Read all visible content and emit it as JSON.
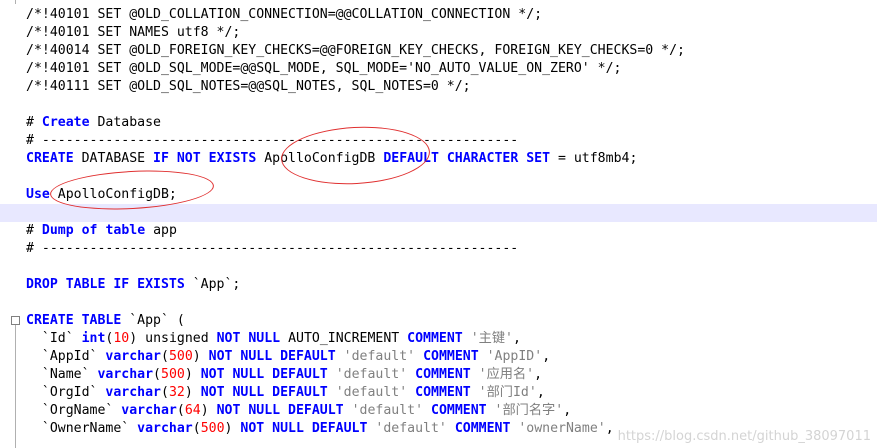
{
  "colors": {
    "keyword": "#0000ff",
    "default_text": "#000000",
    "string": "#808080",
    "number": "#ff0000",
    "active_line_background": "#e8e8ff",
    "annotation": "#e03030",
    "watermark": "#d4d4d4"
  },
  "editor": {
    "lines": [
      {
        "tokens": [
          {
            "t": "/*!40101 SET @OLD_COLLATION_CONNECTION=@@COLLATION_CONNECTION */;",
            "c": "p"
          }
        ]
      },
      {
        "tokens": [
          {
            "t": "/*!40101 SET NAMES utf8 */;",
            "c": "p"
          }
        ]
      },
      {
        "tokens": [
          {
            "t": "/*!40014 SET @OLD_FOREIGN_KEY_CHECKS=@@FOREIGN_KEY_CHECKS, FOREIGN_KEY_CHECKS=0 */;",
            "c": "p"
          }
        ]
      },
      {
        "tokens": [
          {
            "t": "/*!40101 SET @OLD_SQL_MODE=@@SQL_MODE, SQL_MODE='NO_AUTO_VALUE_ON_ZERO' */;",
            "c": "p"
          }
        ]
      },
      {
        "tokens": [
          {
            "t": "/*!40111 SET @OLD_SQL_NOTES=@@SQL_NOTES, SQL_NOTES=0 */;",
            "c": "p"
          }
        ]
      },
      {
        "tokens": []
      },
      {
        "tokens": [
          {
            "t": "# ",
            "c": "p"
          },
          {
            "t": "Create",
            "c": "k"
          },
          {
            "t": " Database",
            "c": "p"
          }
        ]
      },
      {
        "tokens": [
          {
            "t": "# ------------------------------------------------------------",
            "c": "p"
          }
        ]
      },
      {
        "tokens": [
          {
            "t": "CREATE",
            "c": "k"
          },
          {
            "t": " DATABASE ",
            "c": "p"
          },
          {
            "t": "IF NOT EXISTS",
            "c": "k"
          },
          {
            "t": " ApolloConfigDB ",
            "c": "p"
          },
          {
            "t": "DEFAULT CHARACTER SET",
            "c": "k"
          },
          {
            "t": " = utf8mb4;",
            "c": "p"
          }
        ]
      },
      {
        "tokens": []
      },
      {
        "tokens": [
          {
            "t": "Use",
            "c": "k"
          },
          {
            "t": " ApolloConfigDB;",
            "c": "p"
          }
        ]
      },
      {
        "tokens": [],
        "active": true
      },
      {
        "tokens": [
          {
            "t": "# ",
            "c": "p"
          },
          {
            "t": "Dump",
            "c": "k"
          },
          {
            "t": " ",
            "c": "p"
          },
          {
            "t": "of",
            "c": "k"
          },
          {
            "t": " ",
            "c": "p"
          },
          {
            "t": "table",
            "c": "k"
          },
          {
            "t": " app",
            "c": "p"
          }
        ]
      },
      {
        "tokens": [
          {
            "t": "# ------------------------------------------------------------",
            "c": "p"
          }
        ]
      },
      {
        "tokens": []
      },
      {
        "tokens": [
          {
            "t": "DROP TABLE IF EXISTS",
            "c": "k"
          },
          {
            "t": " `App`;",
            "c": "p"
          }
        ]
      },
      {
        "tokens": []
      },
      {
        "tokens": [
          {
            "t": "CREATE TABLE",
            "c": "k"
          },
          {
            "t": " `App` (",
            "c": "p"
          }
        ],
        "fold": true
      },
      {
        "tokens": [
          {
            "t": "  `Id` ",
            "c": "p"
          },
          {
            "t": "int",
            "c": "k"
          },
          {
            "t": "(",
            "c": "p"
          },
          {
            "t": "10",
            "c": "n"
          },
          {
            "t": ") unsigned ",
            "c": "p"
          },
          {
            "t": "NOT NULL",
            "c": "k"
          },
          {
            "t": " AUTO_INCREMENT ",
            "c": "p"
          },
          {
            "t": "COMMENT",
            "c": "k"
          },
          {
            "t": " ",
            "c": "p"
          },
          {
            "t": "'主键'",
            "c": "s"
          },
          {
            "t": ",",
            "c": "p"
          }
        ]
      },
      {
        "tokens": [
          {
            "t": "  `AppId` ",
            "c": "p"
          },
          {
            "t": "varchar",
            "c": "k"
          },
          {
            "t": "(",
            "c": "p"
          },
          {
            "t": "500",
            "c": "n"
          },
          {
            "t": ") ",
            "c": "p"
          },
          {
            "t": "NOT NULL DEFAULT",
            "c": "k"
          },
          {
            "t": " ",
            "c": "p"
          },
          {
            "t": "'default'",
            "c": "s"
          },
          {
            "t": " ",
            "c": "p"
          },
          {
            "t": "COMMENT",
            "c": "k"
          },
          {
            "t": " ",
            "c": "p"
          },
          {
            "t": "'AppID'",
            "c": "s"
          },
          {
            "t": ",",
            "c": "p"
          }
        ]
      },
      {
        "tokens": [
          {
            "t": "  `Name` ",
            "c": "p"
          },
          {
            "t": "varchar",
            "c": "k"
          },
          {
            "t": "(",
            "c": "p"
          },
          {
            "t": "500",
            "c": "n"
          },
          {
            "t": ") ",
            "c": "p"
          },
          {
            "t": "NOT NULL DEFAULT",
            "c": "k"
          },
          {
            "t": " ",
            "c": "p"
          },
          {
            "t": "'default'",
            "c": "s"
          },
          {
            "t": " ",
            "c": "p"
          },
          {
            "t": "COMMENT",
            "c": "k"
          },
          {
            "t": " ",
            "c": "p"
          },
          {
            "t": "'应用名'",
            "c": "s"
          },
          {
            "t": ",",
            "c": "p"
          }
        ]
      },
      {
        "tokens": [
          {
            "t": "  `OrgId` ",
            "c": "p"
          },
          {
            "t": "varchar",
            "c": "k"
          },
          {
            "t": "(",
            "c": "p"
          },
          {
            "t": "32",
            "c": "n"
          },
          {
            "t": ") ",
            "c": "p"
          },
          {
            "t": "NOT NULL DEFAULT",
            "c": "k"
          },
          {
            "t": " ",
            "c": "p"
          },
          {
            "t": "'default'",
            "c": "s"
          },
          {
            "t": " ",
            "c": "p"
          },
          {
            "t": "COMMENT",
            "c": "k"
          },
          {
            "t": " ",
            "c": "p"
          },
          {
            "t": "'部门Id'",
            "c": "s"
          },
          {
            "t": ",",
            "c": "p"
          }
        ]
      },
      {
        "tokens": [
          {
            "t": "  `OrgName` ",
            "c": "p"
          },
          {
            "t": "varchar",
            "c": "k"
          },
          {
            "t": "(",
            "c": "p"
          },
          {
            "t": "64",
            "c": "n"
          },
          {
            "t": ") ",
            "c": "p"
          },
          {
            "t": "NOT NULL DEFAULT",
            "c": "k"
          },
          {
            "t": " ",
            "c": "p"
          },
          {
            "t": "'default'",
            "c": "s"
          },
          {
            "t": " ",
            "c": "p"
          },
          {
            "t": "COMMENT",
            "c": "k"
          },
          {
            "t": " ",
            "c": "p"
          },
          {
            "t": "'部门名字'",
            "c": "s"
          },
          {
            "t": ",",
            "c": "p"
          }
        ]
      },
      {
        "tokens": [
          {
            "t": "  `OwnerName` ",
            "c": "p"
          },
          {
            "t": "varchar",
            "c": "k"
          },
          {
            "t": "(",
            "c": "p"
          },
          {
            "t": "500",
            "c": "n"
          },
          {
            "t": ") ",
            "c": "p"
          },
          {
            "t": "NOT NULL DEFAULT",
            "c": "k"
          },
          {
            "t": " ",
            "c": "p"
          },
          {
            "t": "'default'",
            "c": "s"
          },
          {
            "t": " ",
            "c": "p"
          },
          {
            "t": "COMMENT",
            "c": "k"
          },
          {
            "t": " ",
            "c": "p"
          },
          {
            "t": "'ownerName'",
            "c": "s"
          },
          {
            "t": ",",
            "c": "p"
          }
        ]
      }
    ]
  },
  "annotations": [
    {
      "name": "database-name-highlight",
      "target": "ApolloConfigDB"
    },
    {
      "name": "use-database-highlight",
      "target": "ApolloConfigDB;"
    }
  ],
  "watermark": "https://blog.csdn.net/github_38097011"
}
